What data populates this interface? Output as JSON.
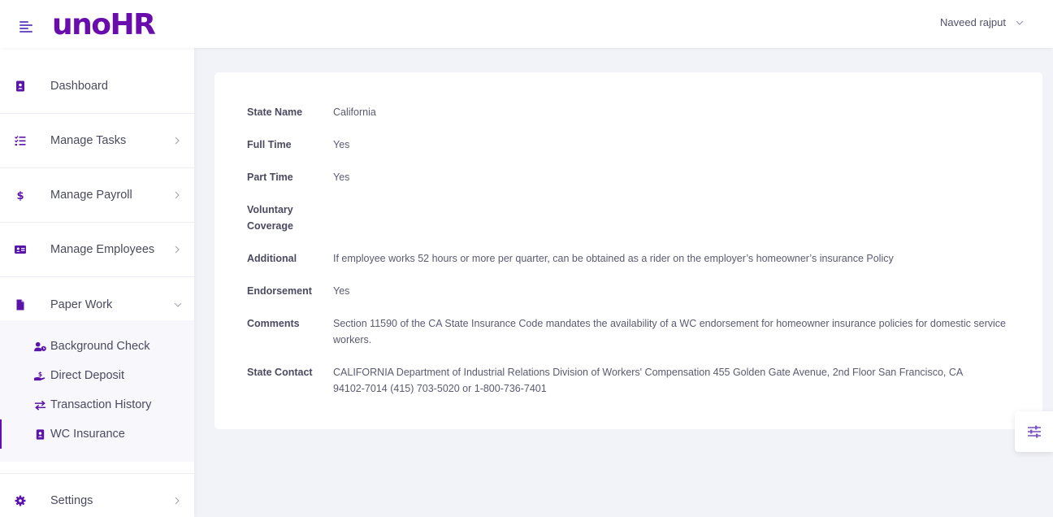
{
  "app": {
    "logo_text": "unoHR",
    "brand_color": "#6a0dad"
  },
  "header": {
    "user_name": "Naveed rajput"
  },
  "sidebar": {
    "items": [
      {
        "label": "Dashboard",
        "icon": "contact-book-icon",
        "has_chevron": false
      },
      {
        "label": "Manage Tasks",
        "icon": "task-list-icon",
        "has_chevron": true
      },
      {
        "label": "Manage Payroll",
        "icon": "dollar-icon",
        "has_chevron": true
      },
      {
        "label": "Manage Employees",
        "icon": "id-card-icon",
        "has_chevron": true
      },
      {
        "label": "Paper Work",
        "icon": "document-icon",
        "has_chevron": true,
        "expanded": true
      },
      {
        "label": "Settings",
        "icon": "gear-icon",
        "has_chevron": true
      }
    ],
    "paperwork_subitems": [
      {
        "label": "Background Check",
        "icon": "user-clock-icon"
      },
      {
        "label": "Direct Deposit",
        "icon": "hand-holding-money-icon"
      },
      {
        "label": "Transaction History",
        "icon": "exchange-arrows-icon"
      },
      {
        "label": "WC Insurance",
        "icon": "contact-book-icon",
        "active": true
      }
    ]
  },
  "details": {
    "rows": [
      {
        "key": "State Name",
        "value": "California"
      },
      {
        "key": "Full Time",
        "value": "Yes"
      },
      {
        "key": "Part Time",
        "value": "Yes"
      },
      {
        "key": "Voluntary Coverage",
        "value": ""
      },
      {
        "key": "Additional",
        "value": "If employee works 52 hours or more per quarter, can be obtained as a rider on the employer’s homeowner’s insurance Policy"
      },
      {
        "key": "Endorsement",
        "value": "Yes"
      },
      {
        "key": "Comments",
        "value": "Section 11590 of the CA State Insurance Code mandates the availability of a WC endorsement for homeowner insurance policies for domestic service workers."
      },
      {
        "key": "State Contact",
        "value": "CALIFORNIA Department of Industrial Relations Division of Workers' Compensation 455 Golden Gate Avenue, 2nd Floor San Francisco, CA 94102-7014 (415) 703-5020 or 1-800-736-7401"
      }
    ]
  },
  "floating_button": {
    "icon": "sliders-icon"
  }
}
